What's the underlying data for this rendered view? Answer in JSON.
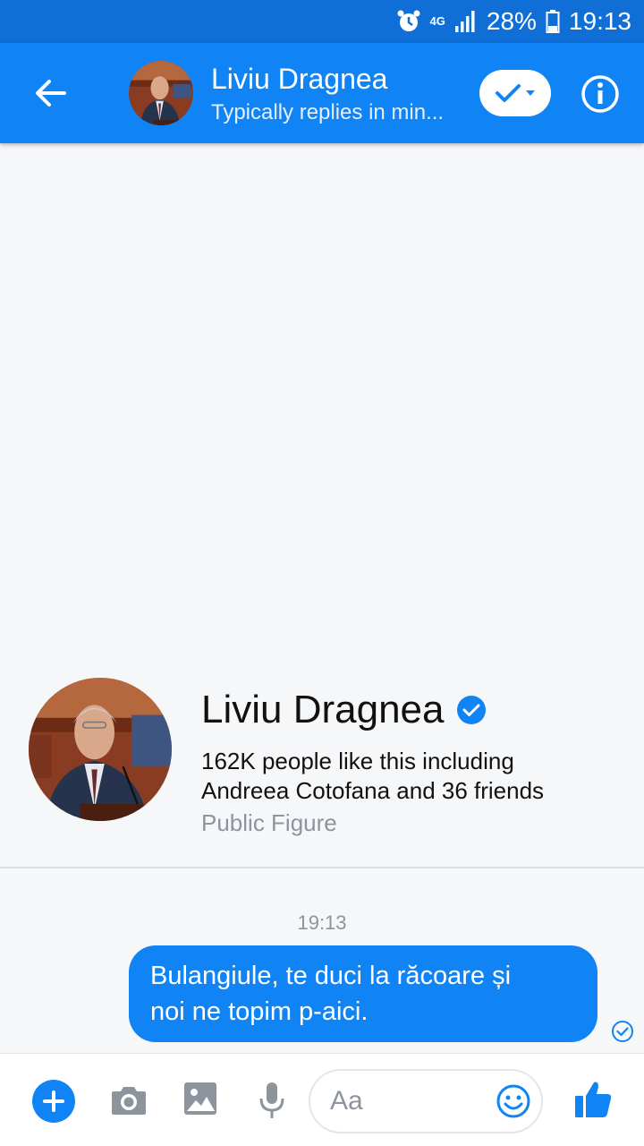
{
  "status_bar": {
    "network": "4G",
    "battery": "28%",
    "time": "19:13",
    "icons": [
      "alarm-icon",
      "signal-icon",
      "battery-icon"
    ]
  },
  "header": {
    "name": "Liviu Dragnea",
    "subtitle": "Typically replies in min...",
    "icons": [
      "back-arrow-icon",
      "checkmark-icon",
      "dropdown-caret-icon",
      "info-icon"
    ]
  },
  "profile": {
    "name": "Liviu Dragnea",
    "likes_line1": "162K people like this including",
    "likes_line2": "Andreea Cotofana and 36 friends",
    "category": "Public Figure",
    "verified": true
  },
  "conversation": {
    "timestamp": "19:13",
    "messages": [
      {
        "from": "me",
        "text_line1": "Bulangiule, te duci la răcoare și",
        "text_line2": "noi ne topim p-aici.",
        "status": "sent"
      }
    ]
  },
  "composer": {
    "placeholder": "Aa",
    "icons": [
      "plus-icon",
      "camera-icon",
      "image-icon",
      "microphone-icon",
      "emoji-icon",
      "thumbs-up-icon"
    ]
  },
  "colors": {
    "status_bar": "#0f6fd6",
    "header": "#1184f5",
    "bubble": "#1184f5",
    "background": "#f6f7f9",
    "muted_text": "#8d949e"
  }
}
